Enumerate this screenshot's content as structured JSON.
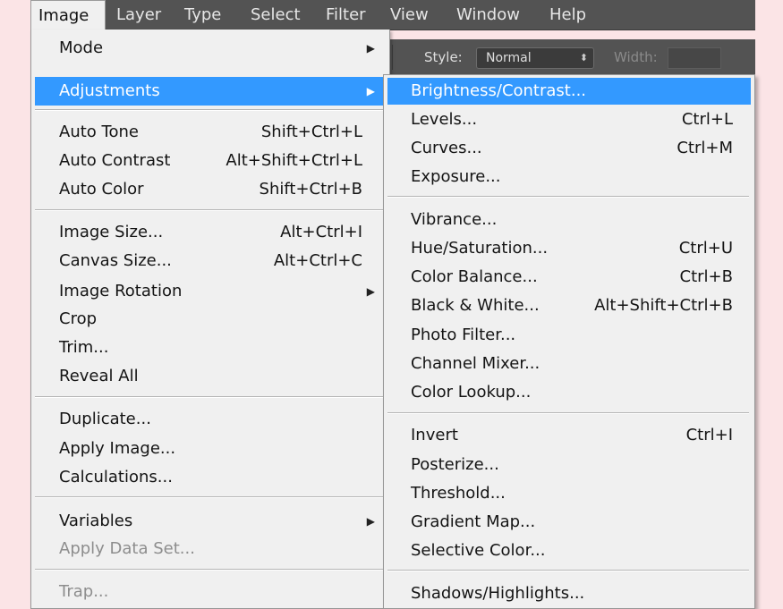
{
  "menubar": {
    "items": [
      "Image",
      "Layer",
      "Type",
      "Select",
      "Filter",
      "View",
      "Window",
      "Help"
    ]
  },
  "options_bar": {
    "style_label": "Style:",
    "style_value": "Normal",
    "width_label": "Width:"
  },
  "image_menu": {
    "items": [
      {
        "label": "Mode",
        "shortcut": "",
        "submenu": true
      },
      {
        "label": "Adjustments",
        "shortcut": "",
        "submenu": true,
        "highlighted": true
      },
      {
        "label": "Auto Tone",
        "shortcut": "Shift+Ctrl+L"
      },
      {
        "label": "Auto Contrast",
        "shortcut": "Alt+Shift+Ctrl+L"
      },
      {
        "label": "Auto Color",
        "shortcut": "Shift+Ctrl+B"
      },
      {
        "label": "Image Size...",
        "shortcut": "Alt+Ctrl+I"
      },
      {
        "label": "Canvas Size...",
        "shortcut": "Alt+Ctrl+C"
      },
      {
        "label": "Image Rotation",
        "shortcut": "",
        "submenu": true
      },
      {
        "label": "Crop",
        "shortcut": ""
      },
      {
        "label": "Trim...",
        "shortcut": ""
      },
      {
        "label": "Reveal All",
        "shortcut": ""
      },
      {
        "label": "Duplicate...",
        "shortcut": ""
      },
      {
        "label": "Apply Image...",
        "shortcut": ""
      },
      {
        "label": "Calculations...",
        "shortcut": ""
      },
      {
        "label": "Variables",
        "shortcut": "",
        "submenu": true
      },
      {
        "label": "Apply Data Set...",
        "shortcut": "",
        "disabled": true
      },
      {
        "label": "Trap...",
        "shortcut": "",
        "disabled": true
      }
    ]
  },
  "adjust_menu": {
    "items": [
      {
        "label": "Brightness/Contrast...",
        "shortcut": "",
        "highlighted": true
      },
      {
        "label": "Levels...",
        "shortcut": "Ctrl+L"
      },
      {
        "label": "Curves...",
        "shortcut": "Ctrl+M"
      },
      {
        "label": "Exposure...",
        "shortcut": ""
      },
      {
        "label": "Vibrance...",
        "shortcut": ""
      },
      {
        "label": "Hue/Saturation...",
        "shortcut": "Ctrl+U"
      },
      {
        "label": "Color Balance...",
        "shortcut": "Ctrl+B"
      },
      {
        "label": "Black & White...",
        "shortcut": "Alt+Shift+Ctrl+B"
      },
      {
        "label": "Photo Filter...",
        "shortcut": ""
      },
      {
        "label": "Channel Mixer...",
        "shortcut": ""
      },
      {
        "label": "Color Lookup...",
        "shortcut": ""
      },
      {
        "label": "Invert",
        "shortcut": "Ctrl+I"
      },
      {
        "label": "Posterize...",
        "shortcut": ""
      },
      {
        "label": "Threshold...",
        "shortcut": ""
      },
      {
        "label": "Gradient Map...",
        "shortcut": ""
      },
      {
        "label": "Selective Color...",
        "shortcut": ""
      },
      {
        "label": "Shadows/Highlights...",
        "shortcut": ""
      }
    ]
  },
  "colors": {
    "menu_bg": "#f0f0f0",
    "highlight": "#3399ff",
    "menubar_bg": "#535353",
    "page_bg": "#fbe4e6"
  }
}
